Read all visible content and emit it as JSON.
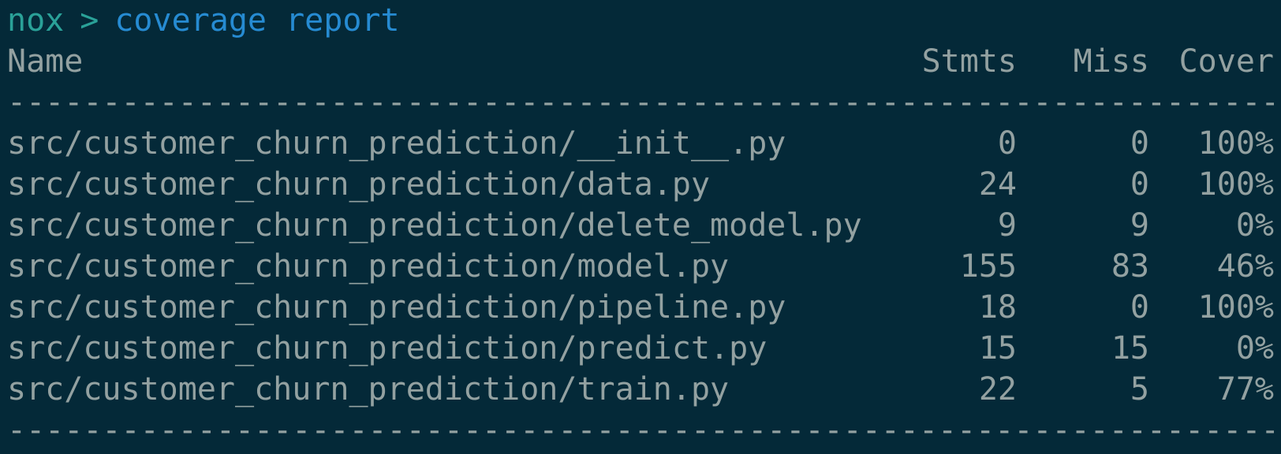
{
  "prompt": {
    "prefix": "nox",
    "separator": ">",
    "command": "coverage report"
  },
  "table": {
    "headers": {
      "name": "Name",
      "stmts": "Stmts",
      "miss": "Miss",
      "cover": "Cover"
    },
    "rule": "-------------------------------------------------------------------------------",
    "rows": [
      {
        "name": "src/customer_churn_prediction/__init__.py",
        "stmts": "0",
        "miss": "0",
        "cover": "100%"
      },
      {
        "name": "src/customer_churn_prediction/data.py",
        "stmts": "24",
        "miss": "0",
        "cover": "100%"
      },
      {
        "name": "src/customer_churn_prediction/delete_model.py",
        "stmts": "9",
        "miss": "9",
        "cover": "0%"
      },
      {
        "name": "src/customer_churn_prediction/model.py",
        "stmts": "155",
        "miss": "83",
        "cover": "46%"
      },
      {
        "name": "src/customer_churn_prediction/pipeline.py",
        "stmts": "18",
        "miss": "0",
        "cover": "100%"
      },
      {
        "name": "src/customer_churn_prediction/predict.py",
        "stmts": "15",
        "miss": "15",
        "cover": "0%"
      },
      {
        "name": "src/customer_churn_prediction/train.py",
        "stmts": "22",
        "miss": "5",
        "cover": "77%"
      }
    ]
  },
  "colors": {
    "background": "#042938",
    "text": "#93a1a1",
    "prompt_prefix": "#2aa198",
    "command": "#268bd2"
  }
}
